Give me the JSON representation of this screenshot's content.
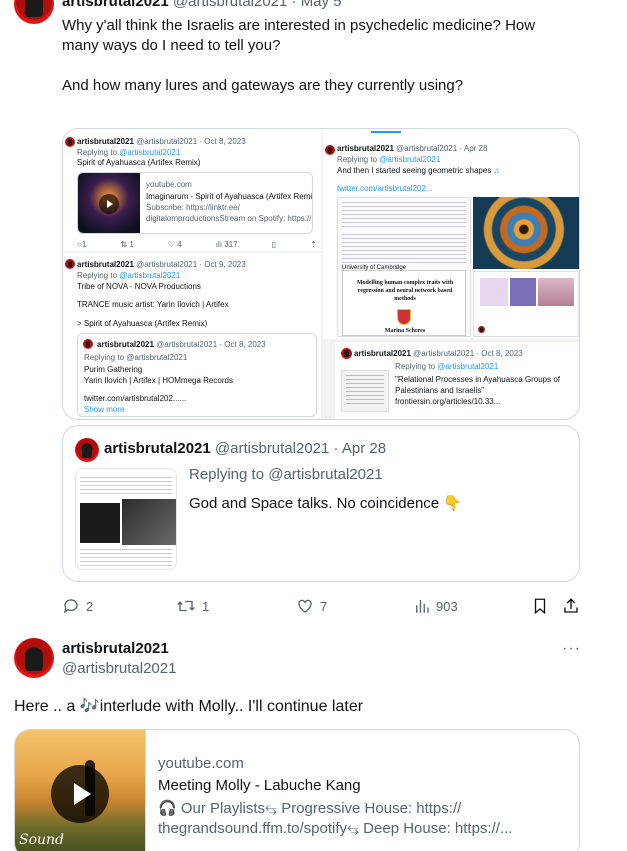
{
  "tweet1": {
    "author_name": "artisbrutal2021",
    "header_handle_date": "@artisbrutal2021 · May 5",
    "text_line1": "Why y'all think the Israelis are interested in psychedelic medicine?  How",
    "text_line2": "many ways do I need to tell you?",
    "text_line3": "And how many lures and gateways are they currently using?",
    "actions": {
      "replies": "2",
      "reposts": "1",
      "likes": "7",
      "views": "903"
    }
  },
  "mosaic": {
    "a": {
      "name": "artisbrutal2021",
      "handle_date": "@artisbrutal2021 · Oct 8, 2023",
      "replying": "Replying to",
      "replying_handle": "@artisbrutal2021",
      "text": "Spirit of Ayahuasca (Artifex Remix)",
      "link_domain": "youtube.com",
      "link_title": "Imaginarum - Spirit of Ayahuasca (Artifex Remix)",
      "link_desc1": "Subscribe: https://linktr.ee/",
      "link_desc2": "digitalomproductionsStream on Spotify: https://...",
      "replies": "1",
      "reposts": "1",
      "likes": "4",
      "views": "317"
    },
    "b": {
      "name": "artisbrutal2021",
      "handle_date": "@artisbrutal2021 · Oct 9, 2023",
      "replying": "Replying to",
      "replying_handle": "@artisbrutal2021",
      "text1": "Tribe of NOVA - NOVA Productions",
      "text2": "TRANCE music artist: Yarin Ilovich | Artifex",
      "text3": "> Spirit of Ayahuasca (Artifex Remix)",
      "quote_name": "artisbrutal2021",
      "quote_handle_date": "@artisbrutal2021 · Oct 8, 2023",
      "quote_replying": "Replying to @artisbrutal2021",
      "quote_line1": "Purim Gathering",
      "quote_line2": "Yarin Ilovich | Artifex | HOMmega Records",
      "quote_line3": "twitter.com/artisbrutal202......",
      "show_more": "Show more"
    },
    "c": {
      "name": "artisbrutal2021",
      "handle_date": "@artisbrutal2021 · Apr 28",
      "replying": "Replying to",
      "replying_handle": "@artisbrutal2021",
      "text": "And then I started seeing geometric shapes",
      "link": "twitter.com/artisbrutal202...",
      "paper_title1": "Modelling human complex traits with",
      "paper_title2": "regression and neural network based",
      "paper_title3": "methods",
      "uni": "University of Cambridge",
      "author": "Marina Scheres"
    },
    "d": {
      "name": "artisbrutal2021",
      "handle_date": "@artisbrutal2021 · Oct 8, 2023",
      "replying": "Replying to",
      "replying_handle": "@artisbrutal2021",
      "text1": "\"Relational Processes in Ayahuasca Groups of",
      "text2": "Palestinians and Israelis\"",
      "text3": "frontiersin.org/articles/10.33..."
    }
  },
  "quote": {
    "name": "artisbrutal2021",
    "handle_date": "@artisbrutal2021 · Apr 28",
    "replying": "Replying to @artisbrutal2021",
    "text": "God and Space talks.  No coincidence",
    "emoji": "👇"
  },
  "tweet2": {
    "name": "artisbrutal2021",
    "handle": "@artisbrutal2021",
    "text": "Here .. a 🎶interlude with Molly.. I'll continue later",
    "link_domain": "youtube.com",
    "link_title": "Meeting Molly - Labuche Kang",
    "link_desc1": "🎧 Our Playlists⥃ Progressive House: https://",
    "link_desc2": "thegrandsound.ffm.to/spotify⥃ Deep House: https://...",
    "thumb_text": "Sound"
  },
  "icons": [
    "more-icon",
    "reply-icon",
    "repost-icon",
    "like-icon",
    "views-icon",
    "bookmark-icon",
    "share-icon",
    "play-icon"
  ]
}
